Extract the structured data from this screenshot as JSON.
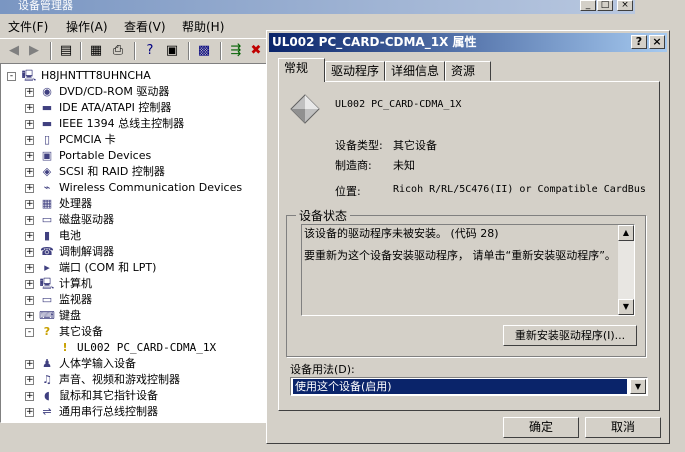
{
  "device_manager": {
    "title": "设备管理器",
    "menus": [
      "文件(F)",
      "操作(A)",
      "查看(V)",
      "帮助(H)"
    ],
    "tree": [
      {
        "label": "H8JHNTTT8UHNCHA",
        "icon": "computer-icon",
        "level": 0,
        "expander": "-"
      },
      {
        "label": "DVD/CD-ROM 驱动器",
        "icon": "cdrom-icon",
        "level": 1,
        "expander": "+"
      },
      {
        "label": "IDE ATA/ATAPI 控制器",
        "icon": "ide-controller-icon",
        "level": 1,
        "expander": "+"
      },
      {
        "label": "IEEE 1394 总线主控制器",
        "icon": "firewire-icon",
        "level": 1,
        "expander": "+"
      },
      {
        "label": "PCMCIA 卡",
        "icon": "pcmcia-icon",
        "level": 1,
        "expander": "+"
      },
      {
        "label": "Portable Devices",
        "icon": "portable-device-icon",
        "level": 1,
        "expander": "+"
      },
      {
        "label": "SCSI 和 RAID 控制器",
        "icon": "scsi-icon",
        "level": 1,
        "expander": "+"
      },
      {
        "label": "Wireless Communication Devices",
        "icon": "wireless-icon",
        "level": 1,
        "expander": "+"
      },
      {
        "label": "处理器",
        "icon": "processor-icon",
        "level": 1,
        "expander": "+"
      },
      {
        "label": "磁盘驱动器",
        "icon": "disk-icon",
        "level": 1,
        "expander": "+"
      },
      {
        "label": "电池",
        "icon": "battery-icon",
        "level": 1,
        "expander": "+"
      },
      {
        "label": "调制解调器",
        "icon": "modem-icon",
        "level": 1,
        "expander": "+"
      },
      {
        "label": "端口 (COM 和 LPT)",
        "icon": "port-icon",
        "level": 1,
        "expander": "+"
      },
      {
        "label": "计算机",
        "icon": "computer-icon",
        "level": 1,
        "expander": "+"
      },
      {
        "label": "监视器",
        "icon": "monitor-icon",
        "level": 1,
        "expander": "+"
      },
      {
        "label": "键盘",
        "icon": "keyboard-icon",
        "level": 1,
        "expander": "+"
      },
      {
        "label": "其它设备",
        "icon": "unknown-device-icon",
        "level": 1,
        "expander": "-"
      },
      {
        "label": "UL002 PC_CARD-CDMA_1X",
        "icon": "warning-device-icon",
        "level": 2,
        "expander": ""
      },
      {
        "label": "人体学输入设备",
        "icon": "hid-icon",
        "level": 1,
        "expander": "+"
      },
      {
        "label": "声音、视频和游戏控制器",
        "icon": "sound-icon",
        "level": 1,
        "expander": "+"
      },
      {
        "label": "鼠标和其它指针设备",
        "icon": "mouse-icon",
        "level": 1,
        "expander": "+"
      },
      {
        "label": "通用串行总线控制器",
        "icon": "usb-icon",
        "level": 1,
        "expander": "+"
      }
    ]
  },
  "dialog": {
    "title": "UL002 PC_CARD-CDMA_1X 属性",
    "help_button": "?",
    "close_button": "×",
    "tabs": [
      "常规",
      "驱动程序",
      "详细信息",
      "资源"
    ],
    "active_tab": 0,
    "device_name": "UL002 PC_CARD-CDMA_1X",
    "device_type_label": "设备类型:",
    "device_type_value": "其它设备",
    "manufacturer_label": "制造商:",
    "manufacturer_value": "未知",
    "location_label": "位置:",
    "location_value": "Ricoh R/RL/5C476(II) or Compatible CardBus",
    "status_group_title": "设备状态",
    "status_line1": "该设备的驱动程序未被安装。 (代码 28)",
    "status_line2": "要重新为这个设备安装驱动程序， 请单击“重新安装驱动程序”。",
    "reinstall_button": "重新安装驱动程序(I)...",
    "usage_label": "设备用法(D):",
    "usage_value": "使用这个设备(启用)",
    "ok_button": "确定",
    "cancel_button": "取消"
  },
  "colors": {
    "titlebar_active": "#0a246a",
    "titlebar_gradient_end": "#a6caf0",
    "window_face": "#d4d0c8",
    "selection": "#0a246a"
  }
}
